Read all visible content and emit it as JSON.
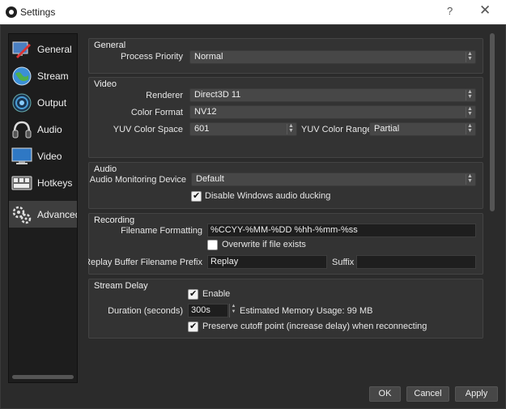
{
  "window": {
    "title": "Settings",
    "help_glyph": "?",
    "close_glyph": "✕"
  },
  "sidebar": {
    "items": [
      {
        "label": "General",
        "icon": "general-icon"
      },
      {
        "label": "Stream",
        "icon": "globe-icon"
      },
      {
        "label": "Output",
        "icon": "output-icon"
      },
      {
        "label": "Audio",
        "icon": "audio-icon"
      },
      {
        "label": "Video",
        "icon": "monitor-icon"
      },
      {
        "label": "Hotkeys",
        "icon": "keyboard-icon"
      },
      {
        "label": "Advanced",
        "icon": "gears-icon",
        "active": true
      }
    ]
  },
  "general": {
    "title": "General",
    "process_priority_label": "Process Priority",
    "process_priority_value": "Normal"
  },
  "video": {
    "title": "Video",
    "renderer_label": "Renderer",
    "renderer_value": "Direct3D 11",
    "color_format_label": "Color Format",
    "color_format_value": "NV12",
    "yuv_space_label": "YUV Color Space",
    "yuv_space_value": "601",
    "yuv_range_label": "YUV Color Range",
    "yuv_range_value": "Partial"
  },
  "audio": {
    "title": "Audio",
    "monitoring_label": "Audio Monitoring Device",
    "monitoring_value": "Default",
    "ducking_label": "Disable Windows audio ducking",
    "ducking_checked": true
  },
  "recording": {
    "title": "Recording",
    "filename_label": "Filename Formatting",
    "filename_value": "%CCYY-%MM-%DD %hh-%mm-%ss",
    "overwrite_label": "Overwrite if file exists",
    "overwrite_checked": false,
    "replay_prefix_label": "Replay Buffer Filename Prefix",
    "replay_prefix_value": "Replay",
    "suffix_label": "Suffix",
    "suffix_value": ""
  },
  "stream_delay": {
    "title": "Stream Delay",
    "enable_label": "Enable",
    "enable_checked": true,
    "duration_label": "Duration (seconds)",
    "duration_value": "300s",
    "memory_text": "Estimated Memory Usage: 99 MB",
    "preserve_label": "Preserve cutoff point (increase delay) when reconnecting",
    "preserve_checked": true
  },
  "buttons": {
    "ok": "OK",
    "cancel": "Cancel",
    "apply": "Apply"
  },
  "colors": {
    "background": "#2b2b2b",
    "panel": "#333333",
    "field": "#1e1e1e",
    "sidebar": "#1d1d1d"
  }
}
